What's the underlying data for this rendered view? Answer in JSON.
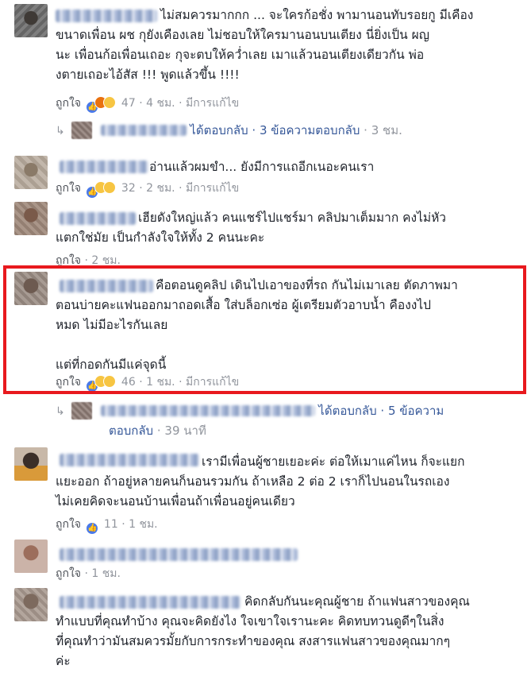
{
  "ui": {
    "like_label": "ถูกใจ",
    "separator": "·",
    "edited_label": "มีการแก้ไข",
    "highlight_color": "#e8191e",
    "link_color": "#365899"
  },
  "comments": [
    {
      "id": "c1",
      "text": "ไม่สมควรมากกก ... จะใครก้อชั่ง พามานอนทับรอยกู มีเคือง\nขนาดเพื่อน ผช กุยังเคืองเลย ไม่ชอบให้ใครมานอนบนเตียง นี่ยิ่งเป็น ผญ\nนะ เพื่อนก้อเพื่อนเถอะ กุจะตบให้คว่ำเลย เมาแล้วนอนเตียงเดียวกัน พ่อ\nงตายเถอะไอ้สัส !!! พูดแล้วขึ้น !!!!",
      "reaction_icons": [
        "like-reaction-icon",
        "angry-reaction-icon",
        "sad-reaction-icon"
      ],
      "count": "47",
      "time": "4 ชม.",
      "edited": true,
      "reply_link": "ได้ตอบกลับ · 3 ข้อความตอบกลับ",
      "reply_time": "3 ชม."
    },
    {
      "id": "c2",
      "text": "อ่านแล้วผมขำ... ยังมีการแถอีกเนอะคนเรา",
      "reaction_icons": [
        "like-reaction-icon",
        "haha-reaction-icon",
        "wow-reaction-icon"
      ],
      "count": "32",
      "time": "2 ชม.",
      "edited": true
    },
    {
      "id": "c3",
      "text": "เฮียดังใหญ่แล้ว คนแชร์ไปแชร์มา คลิปมาเต็มมาก คงไม่หัว\nแตกใช่มัย เป็นกำลังใจให้ทั้ง 2 คนนะคะ",
      "time": "2 ชม."
    },
    {
      "id": "c4",
      "text": "คือตอนดูคลิป เดินไปเอาของที่รถ กันไม่เมาเลย ตัดภาพมา\nตอนบ่ายคะแฟนออกมาถอดเสื้อ ใส่บล็อกเซ่อ ผู้เตรียมตัวอาบน้ำ คืองงไป\nหมด ไม่มีอะไรกันเลย\n\nแต่ที่กอดกันมีแค่จุดนี้",
      "reaction_icons": [
        "like-reaction-icon",
        "sad-reaction-icon",
        "haha-reaction-icon"
      ],
      "count": "46",
      "time": "1 ชม.",
      "edited": true,
      "reply_link": "ได้ตอบกลับ · 5 ข้อความ",
      "reply_link_2": "ตอบกลับ",
      "reply_time": "39 นาที"
    },
    {
      "id": "c5",
      "text": "เรามีเพื่อนผู้ชายเยอะค่ะ ต่อให้เมาแค่ไหน ก็จะแยก\nแยะออก ถ้าอยู่หลายคนก็นอนรวมกัน ถ้าเหลือ 2 ต่อ 2 เราก็ไปนอนในรถเอง\nไม่เคยคิดจะนอนบ้านเพื่อนถ้าเพื่อนอยู่คนเดียว",
      "reaction_icons": [
        "like-reaction-icon"
      ],
      "count": "11",
      "time": "1 ชม."
    },
    {
      "id": "c6",
      "text": "",
      "time": "1 ชม."
    },
    {
      "id": "c7",
      "text": "คิดกลับกันนะคุณผู้ชาย ถ้าแฟนสาวของคุณ\nทำแบบที่คุณทำบ้าง คุณจะคิดยังไง ใจเขาใจเรานะคะ คิดทบทวนดูดีๆในสิ่ง\nที่คุณทำว่ามันสมควรมั้ยกับการกระทำของคุณ สงสารแฟนสาวของคุณมากๆ\nค่ะ"
    }
  ]
}
